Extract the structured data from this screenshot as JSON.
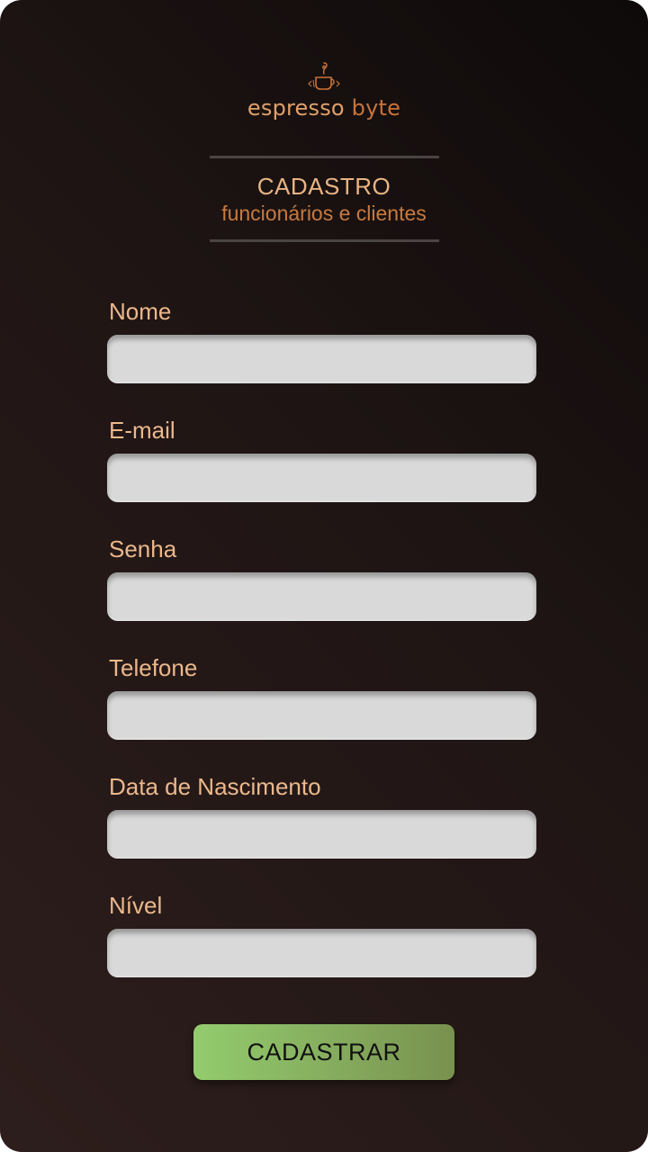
{
  "brand": {
    "word1": "espresso",
    "word2": "byte",
    "icon": "coffee-cup-icon"
  },
  "header": {
    "title": "CADASTRO",
    "subtitle": "funcionários e clientes"
  },
  "form": {
    "fields": [
      {
        "label": "Nome",
        "value": "",
        "placeholder": ""
      },
      {
        "label": "E-mail",
        "value": "",
        "placeholder": ""
      },
      {
        "label": "Senha",
        "value": "",
        "placeholder": ""
      },
      {
        "label": "Telefone",
        "value": "",
        "placeholder": ""
      },
      {
        "label": "Data de Nascimento",
        "value": "",
        "placeholder": ""
      },
      {
        "label": "Nível",
        "value": "",
        "placeholder": ""
      }
    ],
    "submit_label": "CADASTRAR"
  },
  "colors": {
    "label": "#ebb88c",
    "brand_accent": "#c8733a",
    "input_bg": "#d9d9d9",
    "button_start": "#93cc6e",
    "button_end": "#79914f"
  }
}
